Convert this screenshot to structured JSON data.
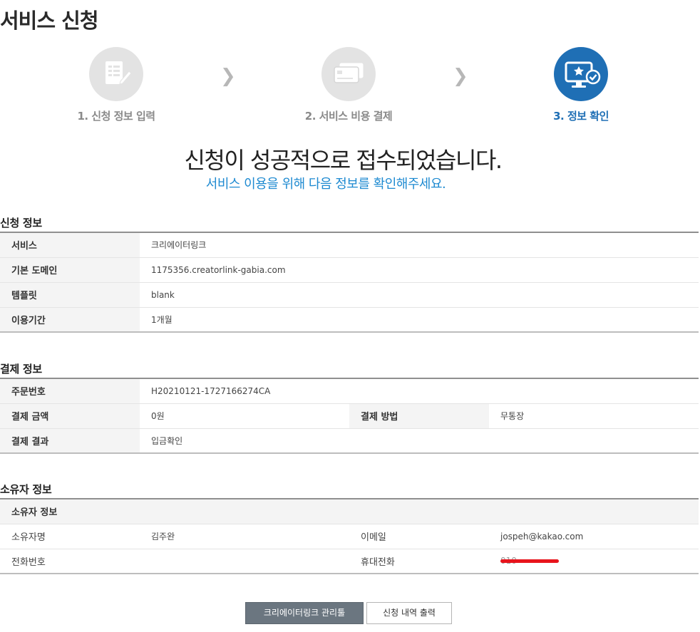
{
  "page_title": "서비스 신청",
  "steps": [
    {
      "label": "1. 신청 정보 입력",
      "icon": "form-edit-icon",
      "state": "done"
    },
    {
      "label": "2. 서비스 비용 결제",
      "icon": "credit-card-icon",
      "state": "done"
    },
    {
      "label": "3. 정보 확인",
      "icon": "monitor-check-icon",
      "state": "active"
    }
  ],
  "headline": "신청이 성공적으로 접수되었습니다.",
  "subline": "서비스 이용을 위해 다음 정보를 확인해주세요.",
  "application": {
    "title": "신청 정보",
    "rows": [
      {
        "label": "서비스",
        "value": "크리에이터링크"
      },
      {
        "label": "기본 도메인",
        "value": "1175356.creatorlink-gabia.com"
      },
      {
        "label": "템플릿",
        "value": "blank"
      },
      {
        "label": "이용기간",
        "value": "1개월"
      }
    ]
  },
  "payment": {
    "title": "결제 정보",
    "order_label": "주문번호",
    "order_value": "H20210121-1727166274CA",
    "amount_label": "결제 금액",
    "amount_value": "0원",
    "method_label": "결제 방법",
    "method_value": "무통장",
    "result_label": "결제 결과",
    "result_value": "입금확인"
  },
  "owner": {
    "title": "소유자 정보",
    "header": "소유자 정보",
    "name_label": "소유자명",
    "name_value": "김주완",
    "email_label": "이메일",
    "email_value": "jospeh@kakao.com",
    "phone_label": "전화번호",
    "phone_value": "",
    "mobile_label": "휴대전화",
    "mobile_value": "010-"
  },
  "buttons": {
    "manage": "크리에이터링크 관리툴",
    "print": "신청 내역 출력"
  },
  "colors": {
    "accent": "#1f6fb5",
    "sub_accent": "#1e8ad1",
    "redaction": "#e8141c"
  }
}
